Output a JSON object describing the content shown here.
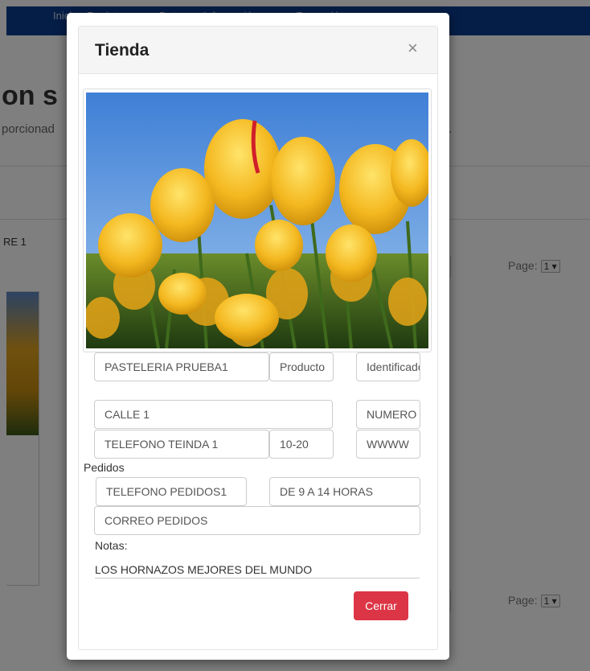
{
  "background": {
    "nav_items": [
      "Inicio",
      "Registrarse",
      "Datos",
      "Información ▼",
      "Formación"
    ],
    "title_fragment": "on s",
    "subtitle_fragment": "porcionad",
    "subtitle_tail": ".",
    "shop_name_fragment": "RE 1",
    "pager_top": {
      "label": "Page:",
      "value": "1"
    },
    "pager_bottom": {
      "label": "Page:",
      "value": "1"
    }
  },
  "modal": {
    "title": "Tienda",
    "close_symbol": "×",
    "image_icon": "tulips-photo",
    "fields": {
      "shop_name": "PASTELERIA PRUEBA1",
      "product": "Producto",
      "identifier": "Identificado",
      "street": "CALLE 1",
      "number": "NUMERO",
      "phone_store": "TELEFONO TEINDA 1",
      "hours": "10-20",
      "website": "WWWW"
    },
    "orders_label": "Pedidos",
    "orders": {
      "phone": "TELEFONO PEDIDOS1",
      "hours": "DE 9 A 14 HORAS",
      "email": "CORREO PEDIDOS"
    },
    "notes_label": "Notas:",
    "notes_value": "LOS HORNAZOS MEJORES DEL MUNDO",
    "close_button": "Cerrar"
  },
  "colors": {
    "navbar": "#0b3d91",
    "close_button": "#dc3545"
  }
}
